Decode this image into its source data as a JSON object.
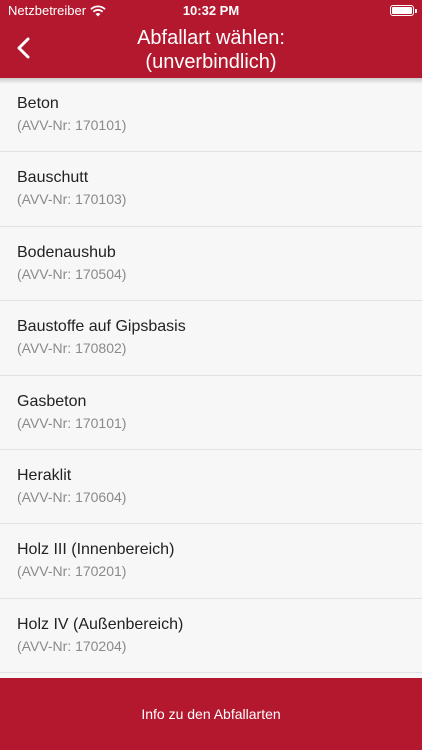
{
  "status_bar": {
    "carrier": "Netzbetreiber",
    "time": "10:32 PM"
  },
  "header": {
    "title_line1": "Abfallart wählen:",
    "title_line2": "(unverbindlich)"
  },
  "items": [
    {
      "name": "Beton",
      "code": "(AVV-Nr: 170101)"
    },
    {
      "name": "Bauschutt",
      "code": "(AVV-Nr: 170103)"
    },
    {
      "name": "Bodenaushub",
      "code": "(AVV-Nr: 170504)"
    },
    {
      "name": "Baustoffe auf Gipsbasis",
      "code": "(AVV-Nr: 170802)"
    },
    {
      "name": "Gasbeton",
      "code": "(AVV-Nr: 170101)"
    },
    {
      "name": "Heraklit",
      "code": "(AVV-Nr: 170604)"
    },
    {
      "name": "Holz III (Innenbereich)",
      "code": "(AVV-Nr: 170201)"
    },
    {
      "name": "Holz IV (Außenbereich)",
      "code": "(AVV-Nr: 170204)"
    }
  ],
  "footer": {
    "label": "Info zu den Abfallarten"
  },
  "icons": {
    "back": "chevron-left-icon",
    "wifi": "wifi-icon",
    "battery": "battery-icon"
  },
  "colors": {
    "brand": "#b3182f",
    "background": "#f7f7f7"
  }
}
